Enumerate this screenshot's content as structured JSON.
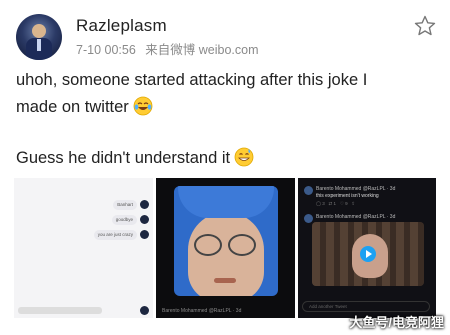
{
  "post": {
    "username": "Razleplasm",
    "timestamp": "7-10 00:56",
    "source": "来自微博 weibo.com",
    "line1": "uhoh, someone started attacking after this joke I",
    "line2": "made on twitter",
    "line3": "Guess he didn't understand it"
  },
  "images": {
    "chat": {
      "messages": [
        "Banhart",
        "goodbye",
        "you are just crazy"
      ]
    },
    "meme": {
      "footer": "Barento Mohammed @RazLPL · 3d"
    },
    "tweets": {
      "tweet1_name": "Barento Mohammed @RazLPL · 3d",
      "tweet1_text": "this experiment isn't working",
      "tweet2_name": "Barento Mohammed @RazLPL · 3d",
      "reply_placeholder": "Add another Tweet"
    }
  },
  "watermark": "大鱼号/电竞阿狸",
  "icons": {
    "star": "star-outline-icon",
    "emoji1": "laughing-tears-emoji",
    "emoji2": "grinning-sweat-emoji"
  },
  "colors": {
    "text": "#222222",
    "meta": "#8a8a8a",
    "twitter_blue": "#1da1f2"
  }
}
